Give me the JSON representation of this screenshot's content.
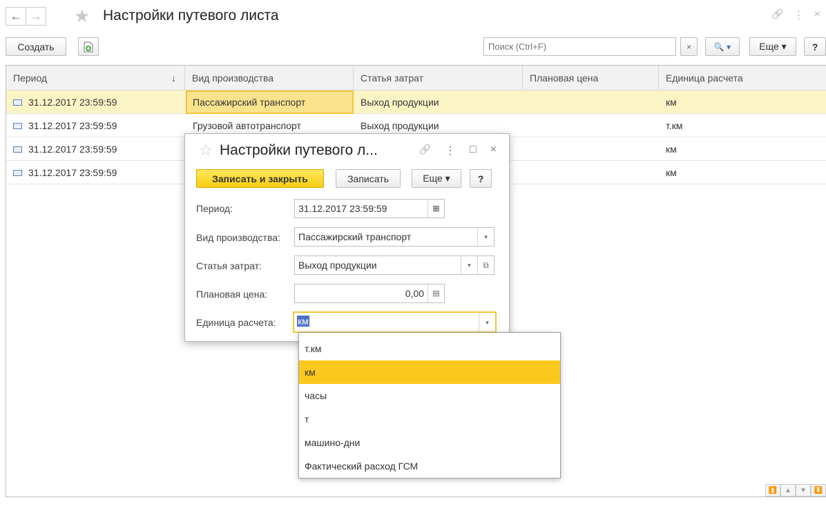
{
  "window": {
    "title": "Настройки путевого листа",
    "nav_back": "←",
    "nav_forward": "→",
    "star": "★",
    "link_icon": "🔗",
    "more_icon": "⋮",
    "close_icon": "×"
  },
  "toolbar": {
    "create_label": "Создать",
    "search_placeholder": "Поиск (Ctrl+F)",
    "search_clear": "×",
    "search_button": "🔍 ▾",
    "more_label": "Еще ▾",
    "help_label": "?"
  },
  "table": {
    "columns": [
      "Период",
      "Вид производства",
      "Статья затрат",
      "Плановая цена",
      "Единица расчета"
    ],
    "sort_indicator": "↓",
    "rows": [
      {
        "period": "31.12.2017 23:59:59",
        "production": "Пассажирский транспорт",
        "cost_item": "Выход продукции",
        "price": "",
        "unit": "км"
      },
      {
        "period": "31.12.2017 23:59:59",
        "production": "Грузовой автотранспорт",
        "cost_item": "Выход продукции",
        "price": "",
        "unit": "т.км"
      },
      {
        "period": "31.12.2017 23:59:59",
        "production": "",
        "cost_item": "",
        "price": "",
        "unit": "км"
      },
      {
        "period": "31.12.2017 23:59:59",
        "production": "",
        "cost_item": "",
        "price": "",
        "unit": "км"
      }
    ]
  },
  "dialog": {
    "title": "Настройки путевого л...",
    "star": "☆",
    "link_icon": "🔗",
    "more_icon": "⋮",
    "maximize_icon": "□",
    "close_icon": "×",
    "save_close_label": "Записать и закрыть",
    "save_label": "Записать",
    "more_label": "Еще ▾",
    "help_label": "?",
    "fields": {
      "period_label": "Период:",
      "period_value": "31.12.2017 23:59:59",
      "production_label": "Вид производства:",
      "production_value": "Пассажирский транспорт",
      "cost_label": "Статья затрат:",
      "cost_value": "Выход продукции",
      "price_label": "Плановая цена:",
      "price_value": "0,00",
      "unit_label": "Единица расчета:",
      "unit_value": "км"
    }
  },
  "dropdown": {
    "options": [
      "т.км",
      "км",
      "часы",
      "т",
      "машино-дни",
      "Фактический расход ГСМ"
    ],
    "selected_index": 1
  },
  "colors": {
    "accent_yellow": "#fbc91e",
    "selected_row": "#fbf5c6",
    "focus_border": "#f4c636"
  }
}
